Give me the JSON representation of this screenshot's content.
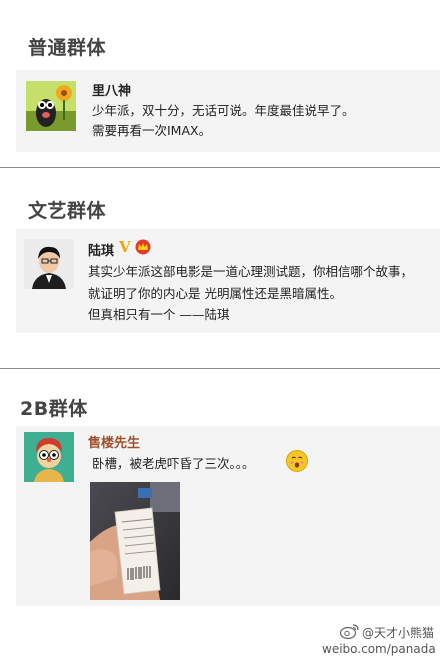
{
  "sections": [
    {
      "title": "普通群体",
      "post": {
        "user": "里八神",
        "lines": [
          "少年派，双十分，无话可说。年度最佳说早了。",
          "需要再看一次IMAX。"
        ]
      }
    },
    {
      "title": "文艺群体",
      "post": {
        "user": "陆琪",
        "badges": [
          "V"
        ],
        "lines": [
          "其实少年派这部电影是一道心理测试题，你相信哪个故事，",
          "就证明了你的内心是  光明属性还是黑暗属性。",
          "但真相只有一个 ——陆琪"
        ]
      }
    },
    {
      "title": "2B群体",
      "post": {
        "user": "售楼先生",
        "lines": [
          "卧槽，被老虎吓昏了三次。。。"
        ]
      }
    }
  ],
  "watermark": {
    "handle": "@天才小熊猫",
    "url": "weibo.com/panada"
  },
  "colors": {
    "card_bg": "#f4f4f4",
    "divider": "#8a8a8a",
    "name_2b": "#a0522d",
    "title": "#444444"
  }
}
